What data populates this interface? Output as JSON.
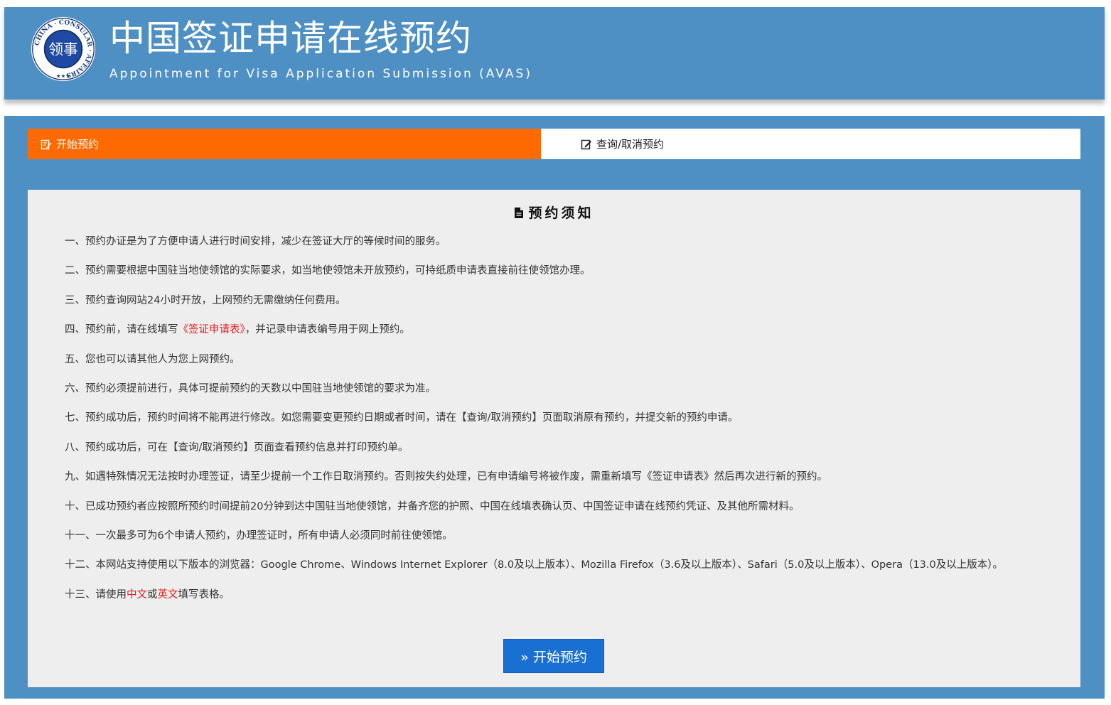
{
  "header": {
    "title": "中国签证申请在线预约",
    "subtitle": "Appointment for Visa Application Submission (AVAS)",
    "logo": {
      "ring_text": "CHINA · CONSULAR · AFFAIRS",
      "center_text": "领事",
      "stars": "★★★"
    }
  },
  "tabs": [
    {
      "label": "开始预约",
      "icon": "edit-form-icon",
      "active": true
    },
    {
      "label": "查询/取消预约",
      "icon": "edit-icon",
      "active": false
    }
  ],
  "notice": {
    "title": "预约须知",
    "title_icon": "document-icon",
    "items": [
      {
        "parts": [
          {
            "text": "一、预约办证是为了方便申请人进行时间安排，减少在签证大厅的等候时间的服务。"
          }
        ]
      },
      {
        "parts": [
          {
            "text": "二、预约需要根据中国驻当地使领馆的实际要求，如当地使领馆未开放预约，可持纸质申请表直接前往使领馆办理。"
          }
        ]
      },
      {
        "parts": [
          {
            "text": "三、预约查询网站24小时开放，上网预约无需缴纳任何费用。"
          }
        ]
      },
      {
        "parts": [
          {
            "text": "四、预约前，请在线填写"
          },
          {
            "text": "《签证申请表》",
            "color": "red",
            "link": true
          },
          {
            "text": "，并记录申请表编号用于网上预约。"
          }
        ]
      },
      {
        "parts": [
          {
            "text": "五、您也可以请其他人为您上网预约。"
          }
        ]
      },
      {
        "parts": [
          {
            "text": "六、预约必须提前进行，具体可提前预约的天数以中国驻当地使领馆的要求为准。"
          }
        ]
      },
      {
        "parts": [
          {
            "text": "七、预约成功后，预约时间将不能再进行修改。如您需要变更预约日期或者时间，请在【查询/取消预约】页面取消原有预约，并提交新的预约申请。"
          }
        ]
      },
      {
        "parts": [
          {
            "text": "八、预约成功后，可在【查询/取消预约】页面查看预约信息并打印预约单。"
          }
        ]
      },
      {
        "parts": [
          {
            "text": "九、如遇特殊情况无法按时办理签证，请至少提前一个工作日取消预约。否则按失约处理，已有申请编号将被作废，需重新填写《签证申请表》然后再次进行新的预约。"
          }
        ]
      },
      {
        "parts": [
          {
            "text": "十、已成功预约者应按照所预约时间提前20分钟到达中国驻当地使领馆，并备齐您的护照、中国在线填表确认页、中国签证申请在线预约凭证、及其他所需材料。"
          }
        ]
      },
      {
        "parts": [
          {
            "text": "十一、一次最多可为6个申请人预约，办理签证时，所有申请人必须同时前往使领馆。"
          }
        ]
      },
      {
        "parts": [
          {
            "text": "十二、本网站支持使用以下版本的浏览器：Google Chrome、Windows Internet Explorer（8.0及以上版本）、Mozilla Firefox（3.6及以上版本）、Safari（5.0及以上版本）、Opera（13.0及以上版本）。"
          }
        ]
      },
      {
        "parts": [
          {
            "text": "十三、请使用"
          },
          {
            "text": "中文",
            "color": "red"
          },
          {
            "text": "或"
          },
          {
            "text": "英文",
            "color": "red"
          },
          {
            "text": "填写表格。"
          }
        ]
      }
    ]
  },
  "start_button": {
    "label": "» 开始预约"
  },
  "colors": {
    "header_bg": "#4f90c4",
    "active_tab": "#ff6a00",
    "content_bg": "#eeeeee",
    "button_bg": "#1a6fd2",
    "highlight": "#e02020"
  }
}
